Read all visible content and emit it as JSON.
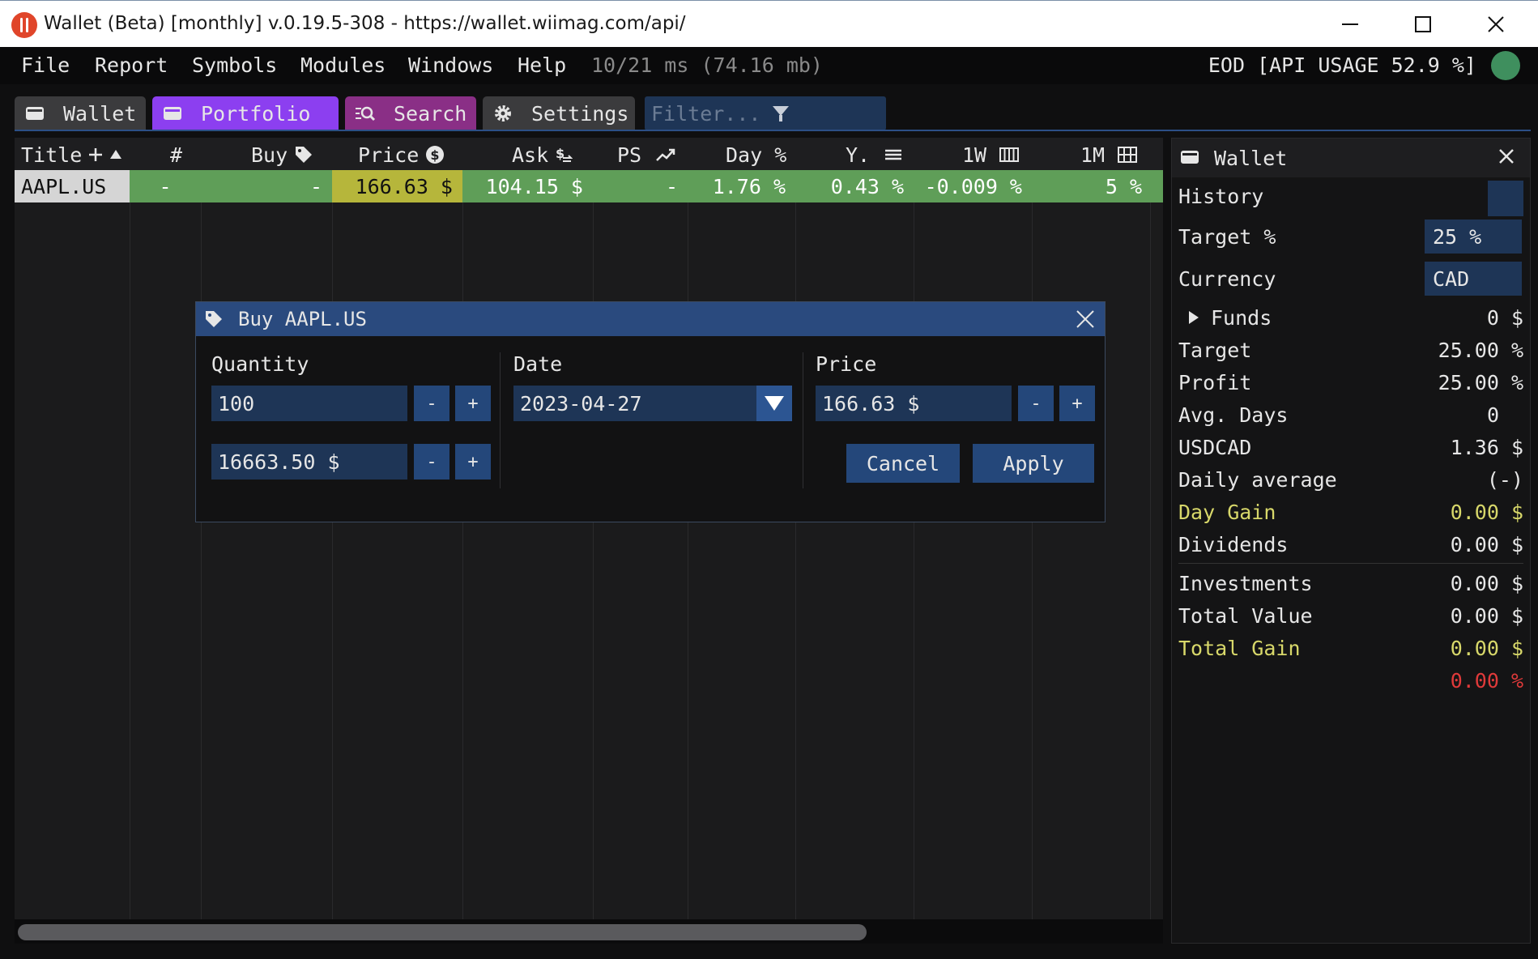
{
  "window": {
    "title": "Wallet (Beta) [monthly] v.0.19.5-308 - https://wallet.wiimag.com/api/"
  },
  "menu": {
    "items": [
      "File",
      "Report",
      "Symbols",
      "Modules",
      "Windows",
      "Help"
    ],
    "stats": "10/21 ms (74.16 mb)",
    "api_usage": "EOD [API USAGE 52.9 %]",
    "status_color": "#3f8f5e"
  },
  "tabs": [
    {
      "label": "Wallet",
      "icon": "wallet-icon"
    },
    {
      "label": "Portfolio",
      "icon": "wallet-icon"
    },
    {
      "label": "Search",
      "icon": "search-list-icon"
    },
    {
      "label": "Settings",
      "icon": "gear-icon"
    }
  ],
  "filter": {
    "placeholder": "Filter..."
  },
  "table": {
    "columns": [
      "Title",
      "#",
      "Buy",
      "Price",
      "Ask",
      "PS",
      "Day %",
      "Y.",
      "1W",
      "1M"
    ],
    "rows": [
      {
        "title": "AAPL.US",
        "count": "-",
        "buy": "-",
        "price": "166.63 $",
        "ask": "104.15 $",
        "ps": "-",
        "day": "1.76 %",
        "y": "0.43 %",
        "w1": "-0.009 %",
        "m1": "5 %"
      }
    ]
  },
  "side": {
    "title": "Wallet",
    "history": "History",
    "target_pct_label": "Target %",
    "target_pct_value": "25 %",
    "currency_label": "Currency",
    "currency_value": "CAD",
    "funds_label": "Funds",
    "funds_value": "0 $",
    "target_label": "Target",
    "target_value": "25.00 %",
    "profit_label": "Profit",
    "profit_value": "25.00 %",
    "avg_days_label": "Avg. Days",
    "avg_days_value": "0",
    "usdcad_label": "USDCAD",
    "usdcad_value": "1.36 $",
    "daily_avg_label": "Daily average",
    "daily_avg_value": "(-)",
    "day_gain_label": "Day Gain",
    "day_gain_value": "0.00 $",
    "dividends_label": "Dividends",
    "dividends_value": "0.00 $",
    "investments_label": "Investments",
    "investments_value": "0.00 $",
    "total_value_label": "Total Value",
    "total_value_value": "0.00 $",
    "total_gain_label": "Total Gain",
    "total_gain_value": "0.00 $",
    "total_gain_pct": "0.00 %"
  },
  "modal": {
    "title": "Buy AAPL.US",
    "quantity_label": "Quantity",
    "quantity_value": "100",
    "amount_value": "16663.50 $",
    "date_label": "Date",
    "date_value": "2023-04-27",
    "price_label": "Price",
    "price_value": "166.63 $",
    "minus": "-",
    "plus": "+",
    "cancel": "Cancel",
    "apply": "Apply"
  }
}
